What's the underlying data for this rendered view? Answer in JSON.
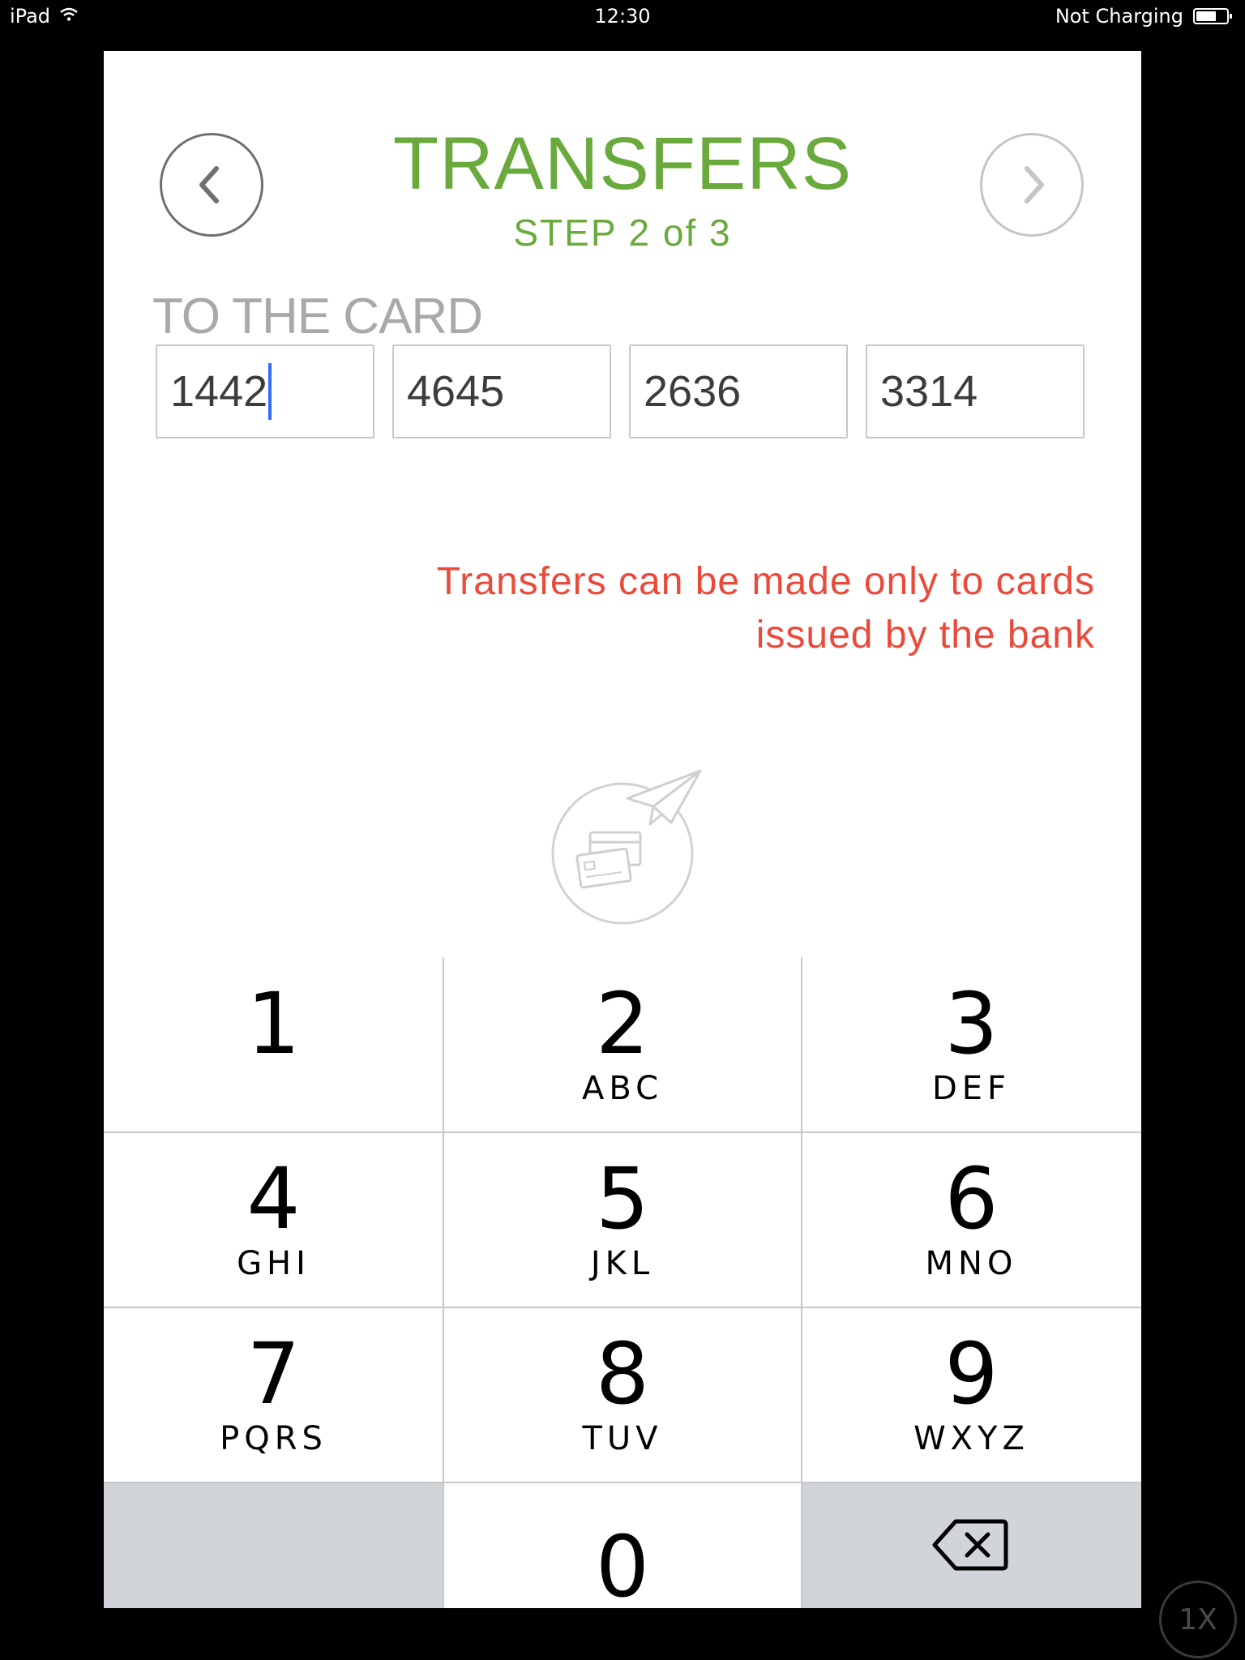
{
  "status_bar": {
    "device": "iPad",
    "time": "12:30",
    "charging": "Not Charging"
  },
  "header": {
    "title": "TRANSFERS",
    "step": "STEP 2 of 3"
  },
  "card": {
    "label": "TO THE CARD",
    "fields": [
      "1442",
      "4645",
      "2636",
      "3314"
    ]
  },
  "warning": {
    "line1": "Transfers can be made only to cards",
    "line2": "issued by the bank"
  },
  "keypad": {
    "keys": [
      {
        "num": "1",
        "letters": ""
      },
      {
        "num": "2",
        "letters": "ABC"
      },
      {
        "num": "3",
        "letters": "DEF"
      },
      {
        "num": "4",
        "letters": "GHI"
      },
      {
        "num": "5",
        "letters": "JKL"
      },
      {
        "num": "6",
        "letters": "MNO"
      },
      {
        "num": "7",
        "letters": "PQRS"
      },
      {
        "num": "8",
        "letters": "TUV"
      },
      {
        "num": "9",
        "letters": "WXYZ"
      },
      {
        "num": "0",
        "letters": ""
      }
    ]
  },
  "zoom_badge": "1X",
  "icons": {
    "back": "chevron-left-icon",
    "next": "chevron-right-icon",
    "transfer": "card-transfer-icon",
    "backspace": "backspace-icon"
  },
  "colors": {
    "accent": "#6aaa3c",
    "warning": "#ea4a3a",
    "caret": "#2f6dff"
  }
}
